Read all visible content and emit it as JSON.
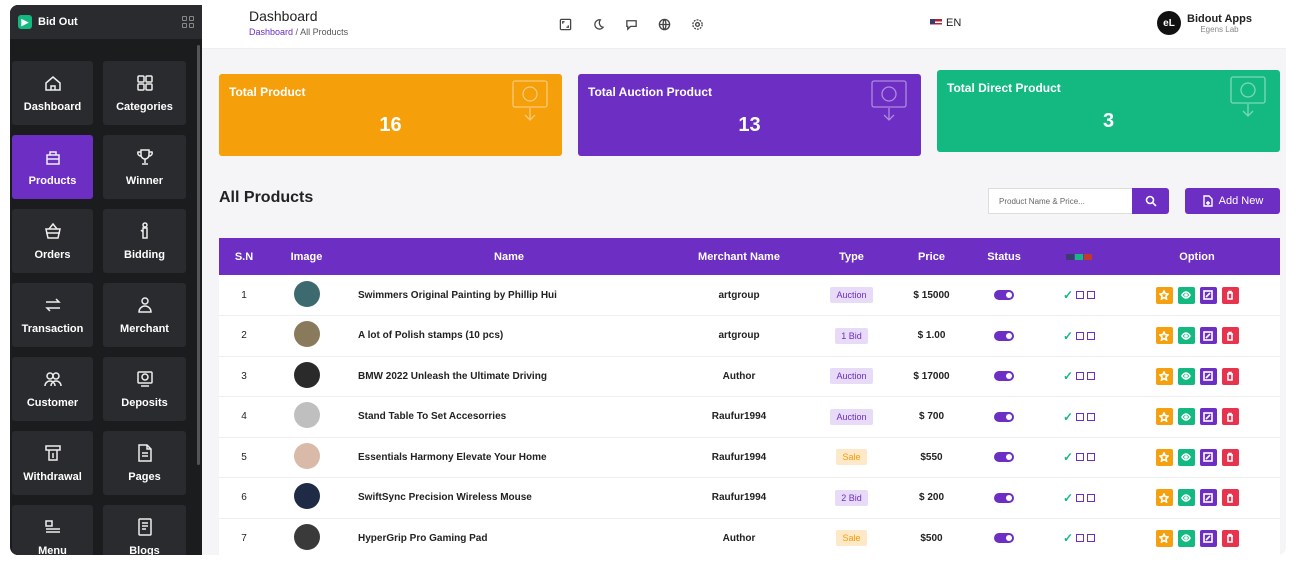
{
  "app": {
    "name": "Bid Out"
  },
  "sidebar": {
    "items": [
      {
        "label": "Dashboard",
        "icon": "home-icon"
      },
      {
        "label": "Categories",
        "icon": "grid-icon"
      },
      {
        "label": "Products",
        "icon": "products-icon",
        "active": true
      },
      {
        "label": "Winner",
        "icon": "trophy-icon"
      },
      {
        "label": "Orders",
        "icon": "basket-icon"
      },
      {
        "label": "Bidding",
        "icon": "bidding-icon"
      },
      {
        "label": "Transaction",
        "icon": "transfer-icon"
      },
      {
        "label": "Merchant",
        "icon": "merchant-icon"
      },
      {
        "label": "Customer",
        "icon": "customer-icon"
      },
      {
        "label": "Deposits",
        "icon": "deposit-icon"
      },
      {
        "label": "Withdrawal",
        "icon": "withdraw-icon"
      },
      {
        "label": "Pages",
        "icon": "pages-icon"
      },
      {
        "label": "Menu",
        "icon": "menu-icon"
      },
      {
        "label": "Blogs",
        "icon": "blog-icon"
      }
    ]
  },
  "header": {
    "title": "Dashboard",
    "breadcrumb": {
      "home": "Dashboard",
      "separator": "/",
      "current": "All Products"
    },
    "language": "EN",
    "user": {
      "initials": "eL",
      "name": "Bidout Apps",
      "role": "Egens Lab"
    }
  },
  "stats": [
    {
      "title": "Total Product",
      "value": "16",
      "color": "#f59f0a"
    },
    {
      "title": "Total Auction Product",
      "value": "13",
      "color": "#6d2ec3"
    },
    {
      "title": "Total Direct Product",
      "value": "3",
      "color": "#13b981"
    }
  ],
  "products": {
    "title": "All Products",
    "search_placeholder": "Product Name & Price...",
    "add_label": "Add New",
    "columns": {
      "sn": "S.N",
      "image": "Image",
      "name": "Name",
      "merchant": "Merchant Name",
      "type": "Type",
      "price": "Price",
      "status": "Status",
      "option": "Option"
    },
    "rows": [
      {
        "sn": "1",
        "name": "Swimmers Original Painting by Phillip Hui",
        "merchant": "artgroup",
        "type": "Auction",
        "type_class": "auction",
        "price": "$ 15000",
        "img": "#3d6a6e"
      },
      {
        "sn": "2",
        "name": "A lot of Polish stamps (10 pcs)",
        "merchant": "artgroup",
        "type": "1 Bid",
        "type_class": "bid",
        "price": "$ 1.00",
        "img": "#8a7a5c"
      },
      {
        "sn": "3",
        "name": "BMW 2022 Unleash the Ultimate Driving",
        "merchant": "Author",
        "type": "Auction",
        "type_class": "auction",
        "price": "$ 17000",
        "img": "#2a2a2a"
      },
      {
        "sn": "4",
        "name": "Stand Table To Set Accesorries",
        "merchant": "Raufur1994",
        "type": "Auction",
        "type_class": "auction",
        "price": "$ 700",
        "img": "#bfbfbf"
      },
      {
        "sn": "5",
        "name": "Essentials Harmony Elevate Your Home",
        "merchant": "Raufur1994",
        "type": "Sale",
        "type_class": "sale",
        "price": "$550",
        "img": "#d9b9a8"
      },
      {
        "sn": "6",
        "name": "SwiftSync Precision Wireless Mouse",
        "merchant": "Raufur1994",
        "type": "2 Bid",
        "type_class": "bid",
        "price": "$ 200",
        "img": "#1f2a44"
      },
      {
        "sn": "7",
        "name": "HyperGrip Pro Gaming Pad",
        "merchant": "Author",
        "type": "Sale",
        "type_class": "sale",
        "price": "$500",
        "img": "#3a3a3a"
      }
    ]
  }
}
